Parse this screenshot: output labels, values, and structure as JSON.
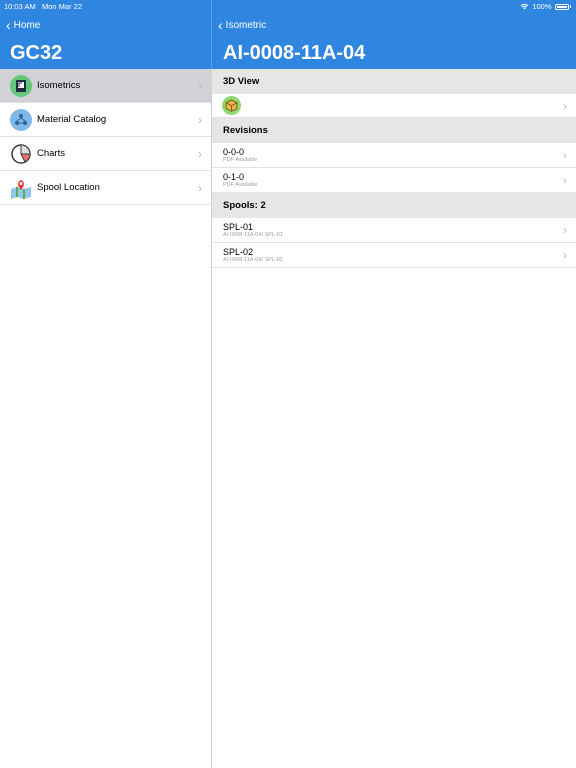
{
  "status_bar": {
    "time": "10:03 AM",
    "date": "Mon Mar 22",
    "battery": "100%"
  },
  "master": {
    "back_label": "Home",
    "title": "GC32",
    "items": [
      {
        "label": "Isometrics",
        "icon": "isometric-drawing-icon",
        "selected": true
      },
      {
        "label": "Material Catalog",
        "icon": "material-catalog-icon",
        "selected": false
      },
      {
        "label": "Charts",
        "icon": "pie-chart-icon",
        "selected": false
      },
      {
        "label": "Spool Location",
        "icon": "map-pin-icon",
        "selected": false
      }
    ]
  },
  "detail": {
    "back_label": "Isometric",
    "title": "AI-0008-11A-04",
    "sections": {
      "view": "3D View",
      "revisions": "Revisions",
      "spools": "Spools: 2"
    },
    "view_icon": "3d-cube-icon",
    "revisions": [
      {
        "title": "0-0-0",
        "subtitle": "PDF Available"
      },
      {
        "title": "0-1-0",
        "subtitle": "PDF Available"
      }
    ],
    "spools": [
      {
        "title": "SPL-01",
        "subtitle": "AI-0008-11A-04/ SPL-01"
      },
      {
        "title": "SPL-02",
        "subtitle": "AI-0008-11A-04/ SPL-02"
      }
    ]
  },
  "colors": {
    "accent": "#2f86e0",
    "selected_row": "#d1d1d6",
    "section_bg": "#e6e6e6"
  }
}
